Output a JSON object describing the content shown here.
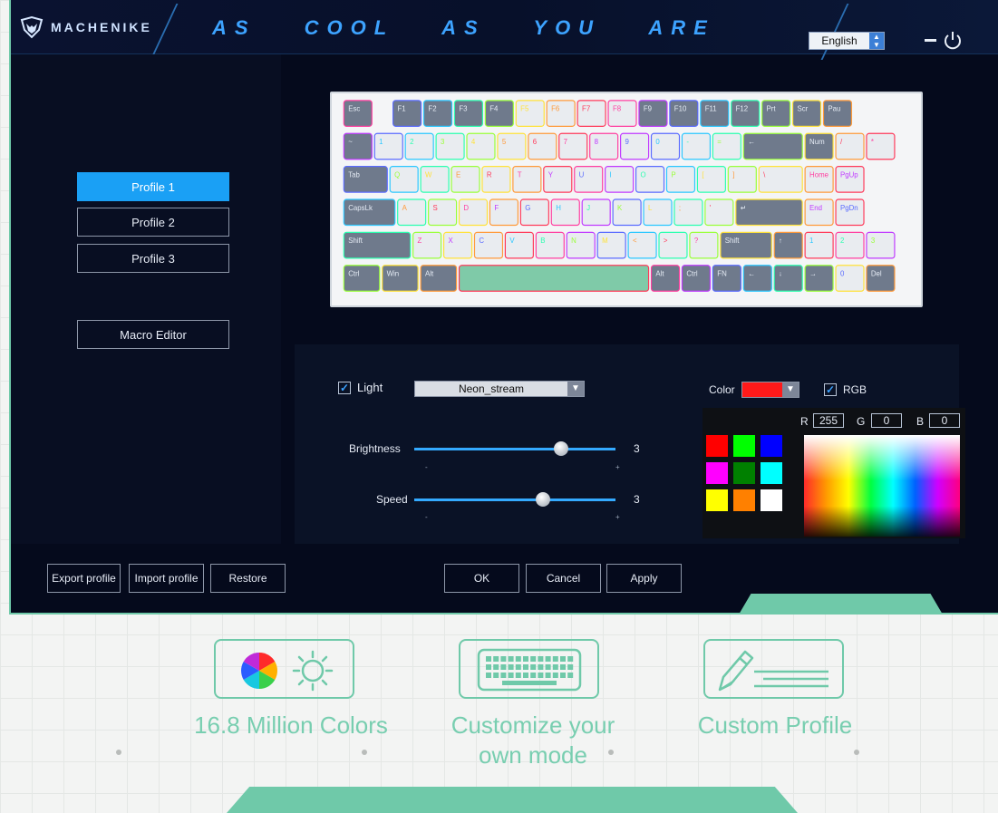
{
  "header": {
    "brand": "MACHENIKE",
    "slogan": "AS COOL AS YOU ARE",
    "language": "English"
  },
  "sidebar": {
    "profiles": [
      {
        "label": "Profile 1",
        "active": true
      },
      {
        "label": "Profile 2",
        "active": false
      },
      {
        "label": "Profile 3",
        "active": false
      }
    ],
    "macro_editor": "Macro Editor"
  },
  "settings": {
    "light_label": "Light",
    "light_checked": true,
    "effect": "Neon_stream",
    "brightness_label": "Brightness",
    "brightness_value": "3",
    "brightness_fraction": 0.73,
    "speed_label": "Speed",
    "speed_value": "3",
    "speed_fraction": 0.64,
    "tick_minus": "-",
    "tick_plus": "+",
    "color_label": "Color",
    "color_value": "#ff1a1a",
    "rgb_label": "RGB",
    "rgb_checked": true,
    "r_label": "R",
    "g_label": "G",
    "b_label": "B",
    "r": "255",
    "g": "0",
    "b": "0",
    "swatches": [
      "#ff0000",
      "#00ff00",
      "#0000ff",
      "#ff00ff",
      "#008000",
      "#00ffff",
      "#ffff00",
      "#ff8000",
      "#ffffff"
    ]
  },
  "footer": {
    "export": "Export profile",
    "import": "Import profile",
    "restore": "Restore",
    "ok": "OK",
    "cancel": "Cancel",
    "apply": "Apply"
  },
  "features": [
    {
      "title": "16.8 Million Colors",
      "icon": "color-wheel-sun-icon"
    },
    {
      "title": "Customize your own mode",
      "line1": "Customize your",
      "line2": "own mode",
      "icon": "keyboard-icon"
    },
    {
      "title": "Custom Profile",
      "icon": "pen-edit-icon"
    }
  ],
  "keyboard": {
    "rows": [
      [
        "Esc",
        "",
        "F1",
        "F2",
        "F3",
        "F4",
        "F5",
        "F6",
        "F7",
        "F8",
        "F9",
        "F10",
        "F11",
        "F12",
        "Prt",
        "Scr",
        "Pau"
      ],
      [
        "~",
        "1",
        "2",
        "3",
        "4",
        "5",
        "6",
        "7",
        "8",
        "9",
        "0",
        "-",
        "=",
        "←",
        "Num",
        "/",
        "*"
      ],
      [
        "Tab",
        "Q",
        "W",
        "E",
        "R",
        "T",
        "Y",
        "U",
        "I",
        "O",
        "P",
        "[",
        "]",
        "\\",
        "Home",
        "PgUp"
      ],
      [
        "CapsLk",
        "A",
        "S",
        "D",
        "F",
        "G",
        "H",
        "J",
        "K",
        "L",
        ";",
        "'",
        "↵",
        "End",
        "PgDn"
      ],
      [
        "Shift",
        "Z",
        "X",
        "C",
        "V",
        "B",
        "N",
        "M",
        "<",
        ">",
        "?",
        "Shift",
        "↑",
        "1",
        "2",
        "3"
      ],
      [
        "Ctrl",
        "Win",
        "Alt",
        "",
        "Alt",
        "Ctrl",
        "FN",
        "←",
        "↓",
        "→",
        "0",
        "Del"
      ]
    ]
  }
}
